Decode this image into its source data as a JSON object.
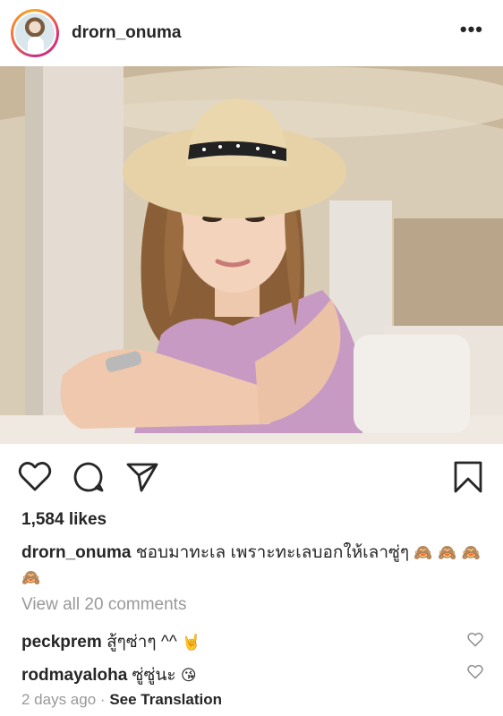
{
  "post": {
    "username": "drorn_onuma",
    "more_icon": "more-horizontal-icon",
    "likes": "1,584 likes",
    "caption": {
      "username": "drorn_onuma",
      "text": "ชอบมาทะเล เพราะทะเลบอกให้เลาซู่ๆ",
      "emojis": "🙈 🙈 🙈 🙈"
    },
    "view_all": "View all 20 comments",
    "comments": [
      {
        "username": "peckprem",
        "text": "สู้ๆซ่าๆ ^^",
        "emoji": "🤘"
      },
      {
        "username": "rodmayaloha",
        "text": "ซู่ซู่นะ",
        "emoji": "😘"
      }
    ],
    "time": "2 days ago",
    "separator": "·",
    "see_translation": "See Translation"
  }
}
